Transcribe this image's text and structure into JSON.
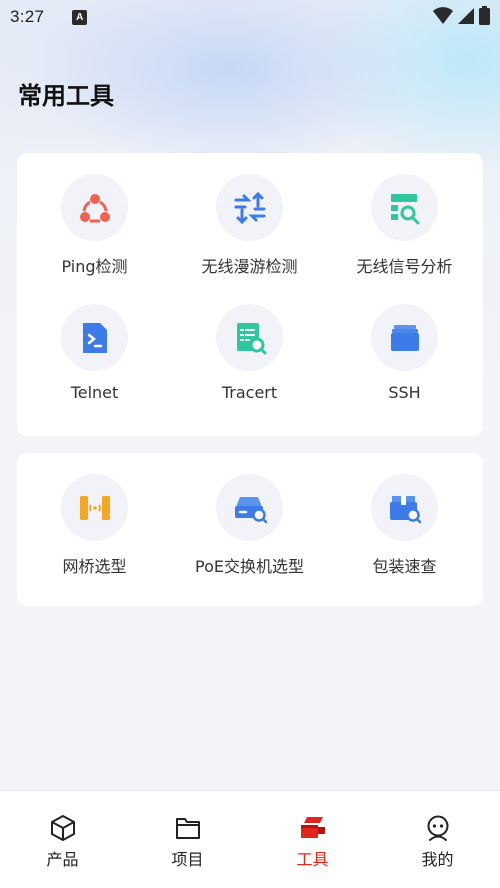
{
  "status_bar": {
    "time": "3:27",
    "app_icon_letter": "A"
  },
  "page": {
    "title": "常用工具"
  },
  "colors": {
    "accent_red": "#e1251b",
    "icon_blue": "#3d7be8",
    "icon_teal": "#2fc6a0",
    "icon_orange": "#f5a623",
    "icon_coral": "#f2604f"
  },
  "card1": {
    "tools": [
      {
        "label": "Ping检测",
        "icon": "share-nodes-icon"
      },
      {
        "label": "无线漫游检测",
        "icon": "roaming-arrows-icon"
      },
      {
        "label": "无线信号分析",
        "icon": "signal-analysis-icon"
      },
      {
        "label": "Telnet",
        "icon": "terminal-file-icon"
      },
      {
        "label": "Tracert",
        "icon": "trace-document-icon"
      },
      {
        "label": "SSH",
        "icon": "folder-stack-icon"
      }
    ]
  },
  "card2": {
    "tools": [
      {
        "label": "网桥选型",
        "icon": "bridge-icon"
      },
      {
        "label": "PoE交换机选型",
        "icon": "switch-search-icon"
      },
      {
        "label": "包装速查",
        "icon": "package-search-icon"
      }
    ]
  },
  "tab_bar": {
    "active": "tools",
    "tabs": [
      {
        "label": "产品",
        "icon": "cube-icon"
      },
      {
        "label": "项目",
        "icon": "folder-icon"
      },
      {
        "label": "工具",
        "icon": "tools-icon"
      },
      {
        "label": "我的",
        "icon": "profile-icon"
      }
    ]
  }
}
